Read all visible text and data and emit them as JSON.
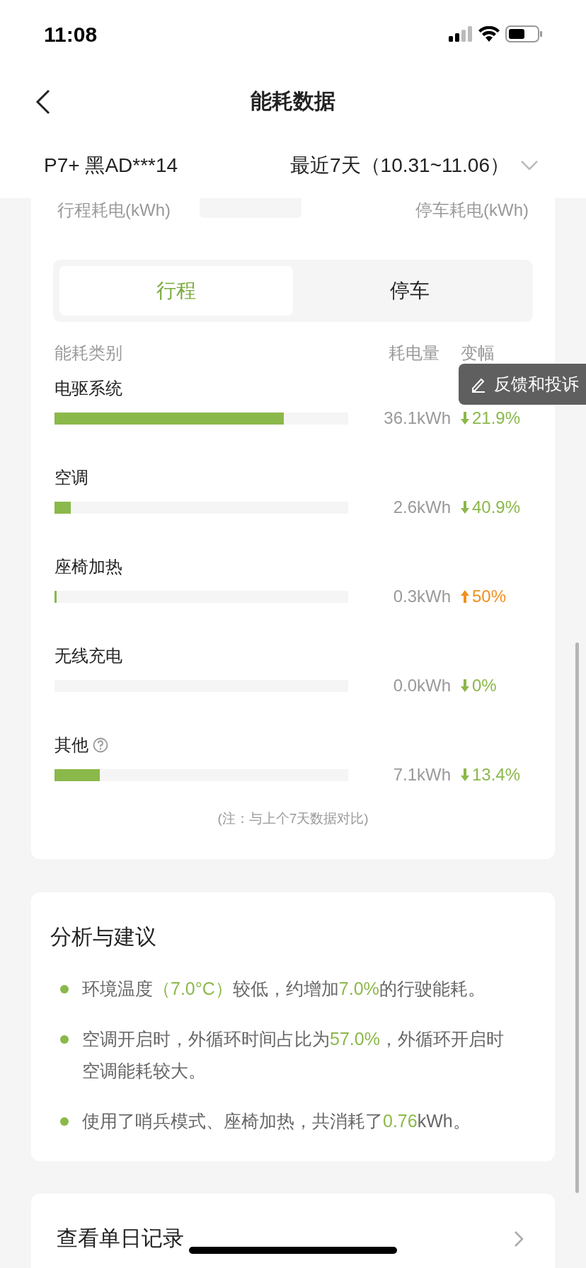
{
  "status_bar": {
    "time": "11:08"
  },
  "nav": {
    "title": "能耗数据"
  },
  "filter": {
    "vehicle": "P7+ 黑AD***14",
    "period": "最近7天（10.31~11.06）"
  },
  "summary": {
    "trip_label": "行程耗电(kWh)",
    "parking_label": "停车耗电(kWh)"
  },
  "tabs": [
    {
      "label": "行程",
      "selected": true
    },
    {
      "label": "停车",
      "selected": false
    }
  ],
  "table": {
    "columns": [
      "能耗类别",
      "耗电量",
      "变幅"
    ],
    "rows": [
      {
        "name": "电驱系统",
        "level": 0.78,
        "amount": "36.1kWh",
        "kind": "down",
        "change": "21.9%"
      },
      {
        "name": "空调",
        "level": 0.055,
        "amount": "2.6kWh",
        "kind": "down",
        "change": "40.9%"
      },
      {
        "name": "座椅加热",
        "level": 0.008,
        "amount": "0.3kWh",
        "kind": "up",
        "change": "50%"
      },
      {
        "name": "无线充电",
        "amount": "0.0kWh",
        "kind": "down",
        "change": "0%"
      },
      {
        "name": "其他",
        "level": 0.154,
        "amount": "7.1kWh",
        "kind": "down",
        "change": "13.4%",
        "help": true
      }
    ],
    "note": "(注：与上个7天数据对比)"
  },
  "feedback_button": {
    "label": "反馈和投诉"
  },
  "analysis": {
    "title": "分析与建议",
    "items": [
      [
        {
          "text": "环境温度",
          "kind": "plain"
        },
        {
          "text": "（7.0°C）",
          "kind": "value"
        },
        {
          "text": "较低，约增加",
          "kind": "plain"
        },
        {
          "text": "7.0%",
          "kind": "value"
        },
        {
          "text": "的行驶能耗。",
          "kind": "plain"
        }
      ],
      [
        {
          "text": "空调开启时，外循环时间占比为",
          "kind": "plain"
        },
        {
          "text": "57.0%",
          "kind": "value"
        },
        {
          "text": "，外循环开启时空调能耗较大。",
          "kind": "plain"
        }
      ],
      [
        {
          "text": "使用了哨兵模式、座椅加热，共消耗了",
          "kind": "plain"
        },
        {
          "text": "0.76",
          "kind": "value"
        },
        {
          "text": "kWh。",
          "kind": "plain"
        }
      ]
    ]
  },
  "daily_link": {
    "label": "查看单日记录"
  }
}
